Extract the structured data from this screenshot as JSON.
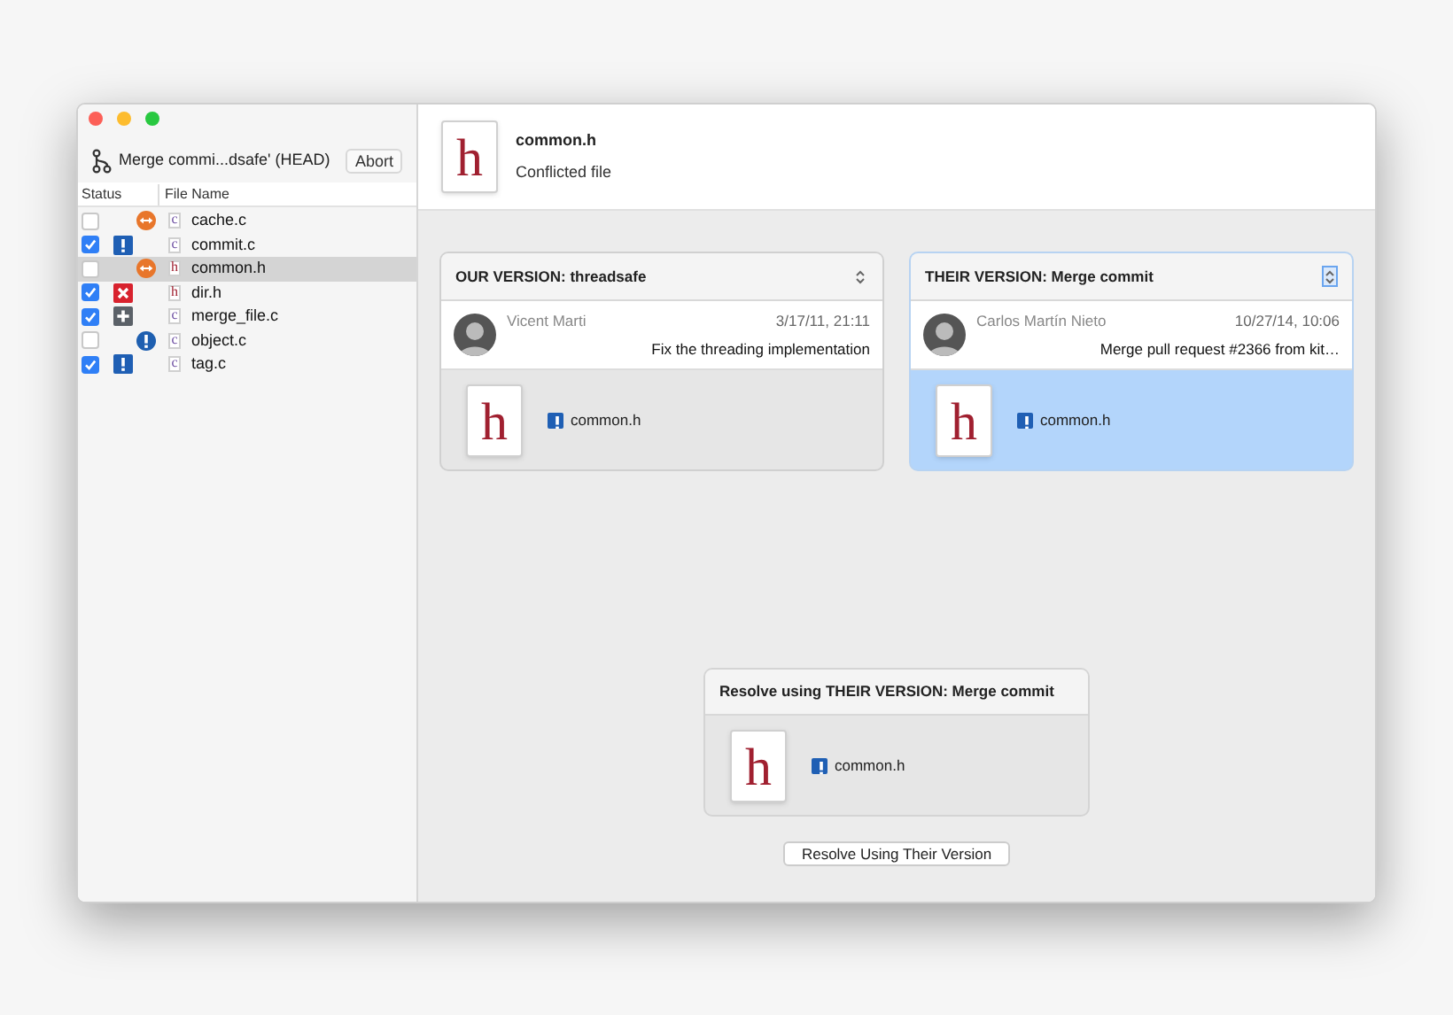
{
  "branch": {
    "title": "Merge commi...dsafe' (HEAD)",
    "abort": "Abort"
  },
  "columns": [
    "Status",
    "File Name"
  ],
  "files": [
    {
      "name": "cache.c",
      "ext": "c",
      "checked": false,
      "kind": "conflict",
      "selected": false
    },
    {
      "name": "commit.c",
      "ext": "c",
      "checked": true,
      "kind": "modified",
      "selected": false
    },
    {
      "name": "common.h",
      "ext": "h",
      "checked": false,
      "kind": "conflict",
      "selected": true
    },
    {
      "name": "dir.h",
      "ext": "h",
      "checked": true,
      "kind": "deleted",
      "selected": false
    },
    {
      "name": "merge_file.c",
      "ext": "c",
      "checked": true,
      "kind": "added",
      "selected": false
    },
    {
      "name": "object.c",
      "ext": "c",
      "checked": false,
      "kind": "notice",
      "selected": false
    },
    {
      "name": "tag.c",
      "ext": "c",
      "checked": true,
      "kind": "modified",
      "selected": false
    }
  ],
  "header": {
    "ext": "h",
    "name": "common.h",
    "subtitle": "Conflicted file"
  },
  "versions": [
    {
      "title": "OUR VERSION: threadsafe",
      "author": "Vicent Marti",
      "date": "3/17/11, 21:11",
      "message": "Fix the threading implementation",
      "ext": "h",
      "file": "common.h",
      "selected": false
    },
    {
      "title": "THEIR VERSION: Merge commit",
      "author": "Carlos Martín Nieto",
      "date": "10/27/14, 10:06",
      "message": "Merge pull request #2366 from kit…",
      "ext": "h",
      "file": "common.h",
      "selected": true
    }
  ],
  "resolve": {
    "title": "Resolve using THEIR VERSION: Merge commit",
    "ext": "h",
    "file": "common.h",
    "button": "Resolve Using Their Version"
  }
}
